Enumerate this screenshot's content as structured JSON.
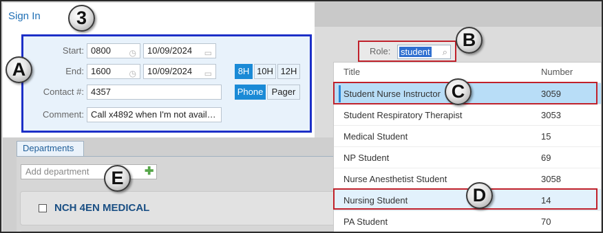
{
  "signin": {
    "title": "Sign In",
    "start_label": "Start:",
    "start_time": "0800",
    "start_date": "10/09/2024",
    "end_label": "End:",
    "end_time": "1600",
    "end_date": "10/09/2024",
    "duration_buttons": [
      "8H",
      "10H",
      "12H"
    ],
    "contact_label": "Contact #:",
    "contact_value": "4357",
    "contact_types": [
      "Phone",
      "Pager"
    ],
    "comment_label": "Comment:",
    "comment_value": "Call x4892 when I'm not avail…"
  },
  "departments": {
    "tab": "Departments",
    "add_placeholder": "Add department",
    "items": [
      "NCH 4EN MEDICAL"
    ]
  },
  "role": {
    "label": "Role:",
    "value": "student"
  },
  "dropdown": {
    "headers": [
      "Title",
      "Number"
    ],
    "rows": [
      {
        "title": "Student Nurse Instructor",
        "number": "3059"
      },
      {
        "title": "Student Respiratory Therapist",
        "number": "3053"
      },
      {
        "title": "Medical Student",
        "number": "15"
      },
      {
        "title": "NP Student",
        "number": "69"
      },
      {
        "title": "Nurse Anesthetist Student",
        "number": "3058"
      },
      {
        "title": "Nursing Student",
        "number": "14"
      },
      {
        "title": "PA Student",
        "number": "70"
      }
    ]
  },
  "callouts": [
    "A",
    "B",
    "C",
    "D",
    "E",
    "3"
  ],
  "colors": {
    "accent_blue": "#1a8ad6",
    "callout_box_blue": "#1c2fc7",
    "highlight_red": "#c0202a",
    "selected_row": "#b8ddf7"
  }
}
